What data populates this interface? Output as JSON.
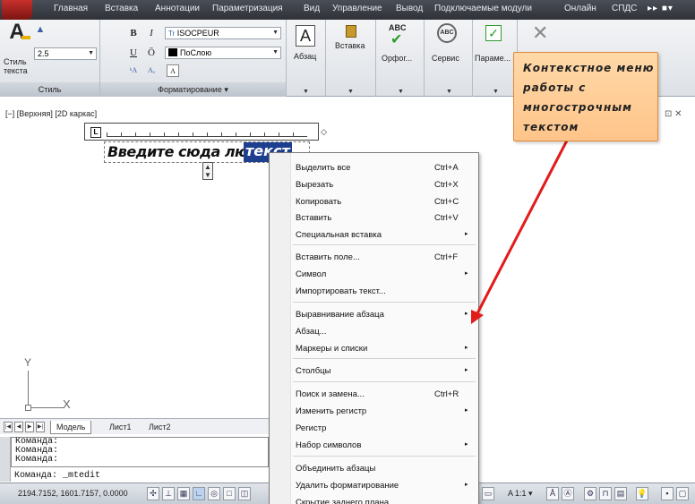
{
  "tabs": [
    "Главная",
    "Вставка",
    "Аннотации",
    "Параметризация",
    "Вид",
    "Управление",
    "Вывод",
    "Подключаемые модули",
    "Онлайн",
    "СПДС"
  ],
  "tabbar_more": "▸▸ ■▾",
  "ribbon": {
    "style_group": {
      "height_value": "2.5",
      "label_line1": "Стиль",
      "label_line2": "текста",
      "title": "Стиль"
    },
    "format_group": {
      "font": "ISOCPEUR",
      "font_prefix": "Tr",
      "color": "ПоСлою",
      "bold": "B",
      "italic": "I",
      "underline": "U",
      "overline": "Ō",
      "title": "Форматирование ▾"
    },
    "paragraph_label": "Абзац",
    "insert_label": "Вставка",
    "spell_label": "Орфог...",
    "spell_icon_text": "ABC",
    "service_label": "Сервис",
    "service_icon_text": "ABC",
    "params_label": "Параме...",
    "close_icon": "close-icon"
  },
  "viewport": {
    "label": "[−] [Верхняя] [2D каркас]",
    "controls": "⊡ ✕"
  },
  "ruler": {
    "left_button": "L",
    "end_marker": "◇"
  },
  "mtext": {
    "plain": "Введите сюда любой",
    "selected": "текст"
  },
  "ucs": {
    "y": "Y",
    "x": "X"
  },
  "layout_tabs": [
    "Модель",
    "Лист1",
    "Лист2"
  ],
  "command": {
    "history": [
      "Команда:",
      "Команда:",
      "Команда:"
    ],
    "current": "Команда:  _mtedit"
  },
  "status": {
    "coords": "2194.7152, 1601.7157, 0.0000",
    "scale": "A 1:1 ▾"
  },
  "context_menu": {
    "items": [
      {
        "label": "Выделить все",
        "shortcut": "Ctrl+A",
        "submenu": false
      },
      {
        "label": "Вырезать",
        "shortcut": "Ctrl+X",
        "submenu": false
      },
      {
        "label": "Копировать",
        "shortcut": "Ctrl+C",
        "submenu": false
      },
      {
        "label": "Вставить",
        "shortcut": "Ctrl+V",
        "submenu": false
      },
      {
        "label": "Специальная вставка",
        "shortcut": "",
        "submenu": true
      },
      {
        "label": "Вставить поле...",
        "shortcut": "Ctrl+F",
        "submenu": false
      },
      {
        "label": "Символ",
        "shortcut": "",
        "submenu": true
      },
      {
        "label": "Импортировать текст...",
        "shortcut": "",
        "submenu": false
      },
      {
        "label": "Выравнивание абзаца",
        "shortcut": "",
        "submenu": true
      },
      {
        "label": "Абзац...",
        "shortcut": "",
        "submenu": false
      },
      {
        "label": "Маркеры и списки",
        "shortcut": "",
        "submenu": true
      },
      {
        "label": "Столбцы",
        "shortcut": "",
        "submenu": true
      },
      {
        "label": "Поиск и замена...",
        "shortcut": "Ctrl+R",
        "submenu": false
      },
      {
        "label": "Изменить регистр",
        "shortcut": "",
        "submenu": true
      },
      {
        "label": "Регистр",
        "shortcut": "",
        "submenu": false
      },
      {
        "label": "Набор символов",
        "shortcut": "",
        "submenu": true
      },
      {
        "label": "Объединить абзацы",
        "shortcut": "",
        "submenu": false
      },
      {
        "label": "Удалить форматирование",
        "shortcut": "",
        "submenu": true
      },
      {
        "label": "Скрытие заднего плана",
        "shortcut": "",
        "submenu": false
      }
    ],
    "submenu_arrow": "▸"
  },
  "callout": {
    "text": "Контекстное меню работы с многострочным текстом",
    "border_color": "#e08a3a",
    "arrow_color": "#e21b1b"
  }
}
